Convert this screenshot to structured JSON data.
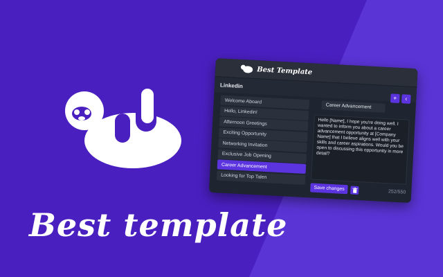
{
  "hero": {
    "title": "Best template"
  },
  "window": {
    "title": "Best Template",
    "section_title": "Linkedin",
    "add_icon": "plus-icon",
    "collapse_icon": "chevron-left-icon",
    "templates": [
      "Welcome Aboard",
      "Hello, Linkedin!",
      "Afternoon Greetings",
      "Exciting Opportunity",
      "Networking Invitation",
      "Exclusive Job Opening",
      "Career Advancement",
      "Looking for Top Talen"
    ],
    "active_index": 6,
    "template_name": "Career Advancement",
    "template_body": "Hello [Name], I hope you're doing well. I wanted to inform you about a career advancement opportunity at [Company Name] that I believe aligns well with your skills and career aspirations. Would you be open to discussing this opportunity in more detail?",
    "save_label": "Save changes",
    "char_count": "252/550"
  },
  "colors": {
    "background": "#4a1fc0",
    "background_light": "#5b34d6",
    "accent": "#5b34e0",
    "window": "#1f2530"
  }
}
